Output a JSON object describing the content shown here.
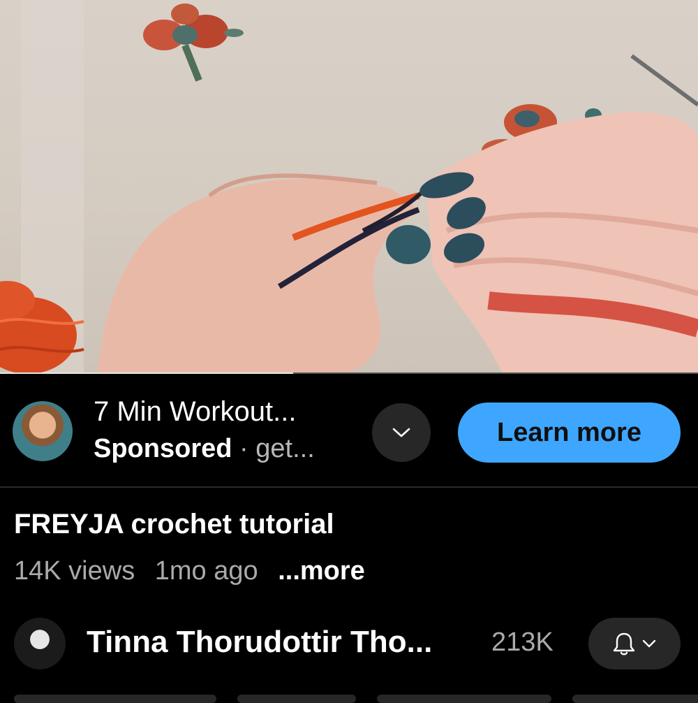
{
  "video": {
    "description_icon": "video-frame",
    "progress_fraction": 0.42
  },
  "ad": {
    "title": "7 Min Workout...",
    "sponsored": "Sponsored",
    "separator": "·",
    "domain": "get...",
    "cta_label": "Learn more",
    "cta_color": "#3ea6ff",
    "expand_icon": "chevron-down-icon"
  },
  "video_info": {
    "title": "FREYJA crochet tutorial",
    "views": "14K views",
    "age": "1mo ago",
    "more_label": "...more"
  },
  "channel": {
    "name": "Tinna Thorudottir Tho...",
    "subscribers": "213K",
    "notify_icon": "bell-icon",
    "dropdown_icon": "chevron-down-icon"
  }
}
